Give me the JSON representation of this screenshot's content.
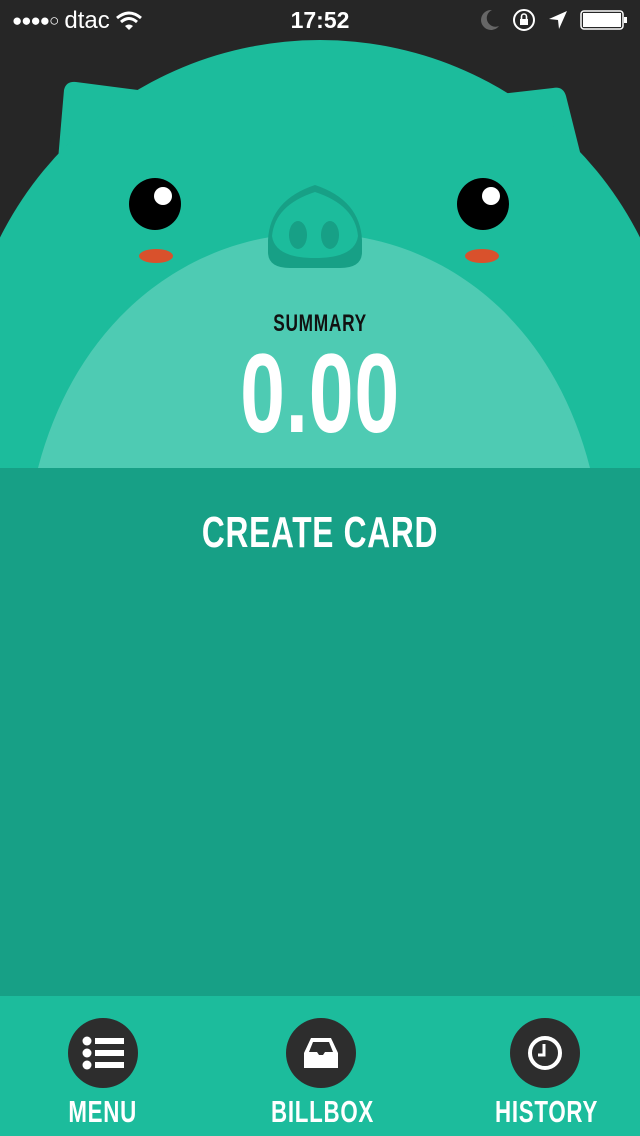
{
  "status_bar": {
    "carrier": "dtac",
    "time": "17:52",
    "signal_bars": 4,
    "battery_percent": 100
  },
  "summary": {
    "label": "SUMMARY",
    "value": "0.00"
  },
  "main": {
    "create_card_label": "CREATE CARD"
  },
  "tabs": [
    {
      "label": "MENU",
      "icon": "list-icon"
    },
    {
      "label": "BILLBOX",
      "icon": "inbox-icon"
    },
    {
      "label": "HISTORY",
      "icon": "clock-icon"
    }
  ],
  "colors": {
    "background": "#262626",
    "pig": "#1cbc9c",
    "content": "#17a086",
    "cheek": "#d9512c"
  }
}
